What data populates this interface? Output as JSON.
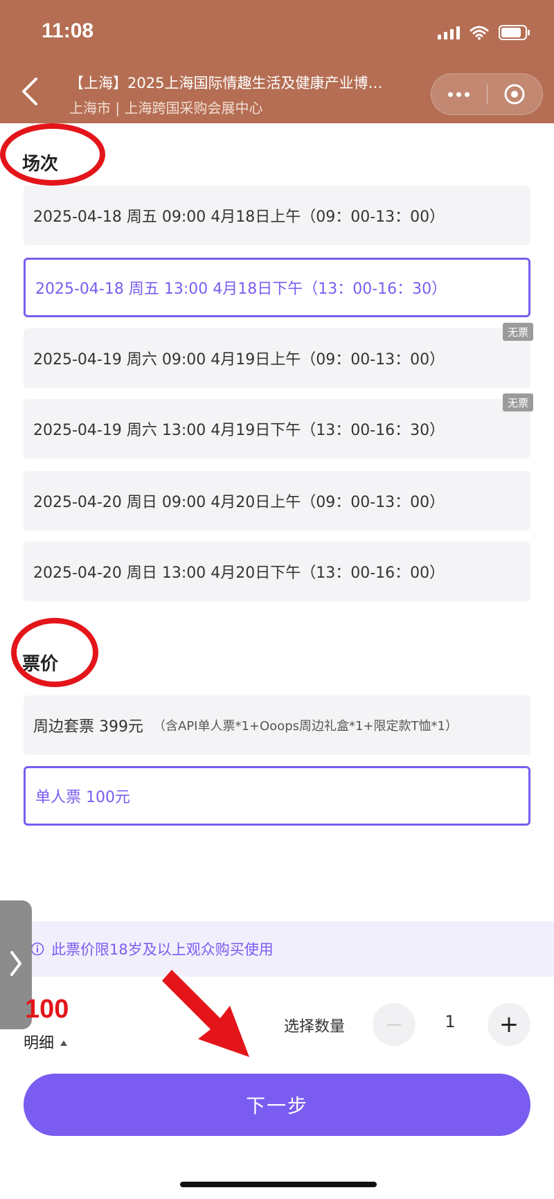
{
  "status_bar": {
    "time": "11:08"
  },
  "nav": {
    "title": "【上海】2025上海国际情趣生活及健康产业博…",
    "subtitle": "上海市 | 上海跨国采购会展中心"
  },
  "sessions": {
    "title": "场次",
    "items": [
      {
        "label": "2025-04-18 周五 09:00 4月18日上午（09：00-13：00）",
        "selected": false,
        "badge": ""
      },
      {
        "label": "2025-04-18 周五 13:00 4月18日下午（13：00-16：30）",
        "selected": true,
        "badge": ""
      },
      {
        "label": "2025-04-19 周六 09:00 4月19日上午（09：00-13：00）",
        "selected": false,
        "badge": "无票"
      },
      {
        "label": "2025-04-19 周六 13:00 4月19日下午（13：00-16：30）",
        "selected": false,
        "badge": "无票"
      },
      {
        "label": "2025-04-20 周日 09:00 4月20日上午（09：00-13：00）",
        "selected": false,
        "badge": ""
      },
      {
        "label": "2025-04-20 周日 13:00 4月20日下午（13：00-16：00）",
        "selected": false,
        "badge": ""
      }
    ]
  },
  "prices": {
    "title": "票价",
    "items": [
      {
        "label": "周边套票 399元",
        "note": "（含API单人票*1+Ooops周边礼盒*1+限定款T恤*1）",
        "selected": false
      },
      {
        "label": "单人票 100元",
        "note": "",
        "selected": true
      }
    ]
  },
  "notice": {
    "text": "此票价限18岁及以上观众购买使用"
  },
  "footer": {
    "price": "100",
    "detail_label": "明细",
    "qty_label": "选择数量",
    "qty_value": "1",
    "minus": "—",
    "plus": "+",
    "next_label": "下一步"
  },
  "colors": {
    "header": "#b56e53",
    "accent": "#7a5cf0",
    "highlight": "#e3151a",
    "option_bg": "#f4f4f6",
    "badge": "#9b9b9b"
  },
  "icons": [
    "back-chevron-icon",
    "more-dots-icon",
    "target-icon",
    "info-icon",
    "caret-up-icon",
    "chevron-right-icon",
    "signal-icon",
    "wifi-icon",
    "battery-icon"
  ]
}
